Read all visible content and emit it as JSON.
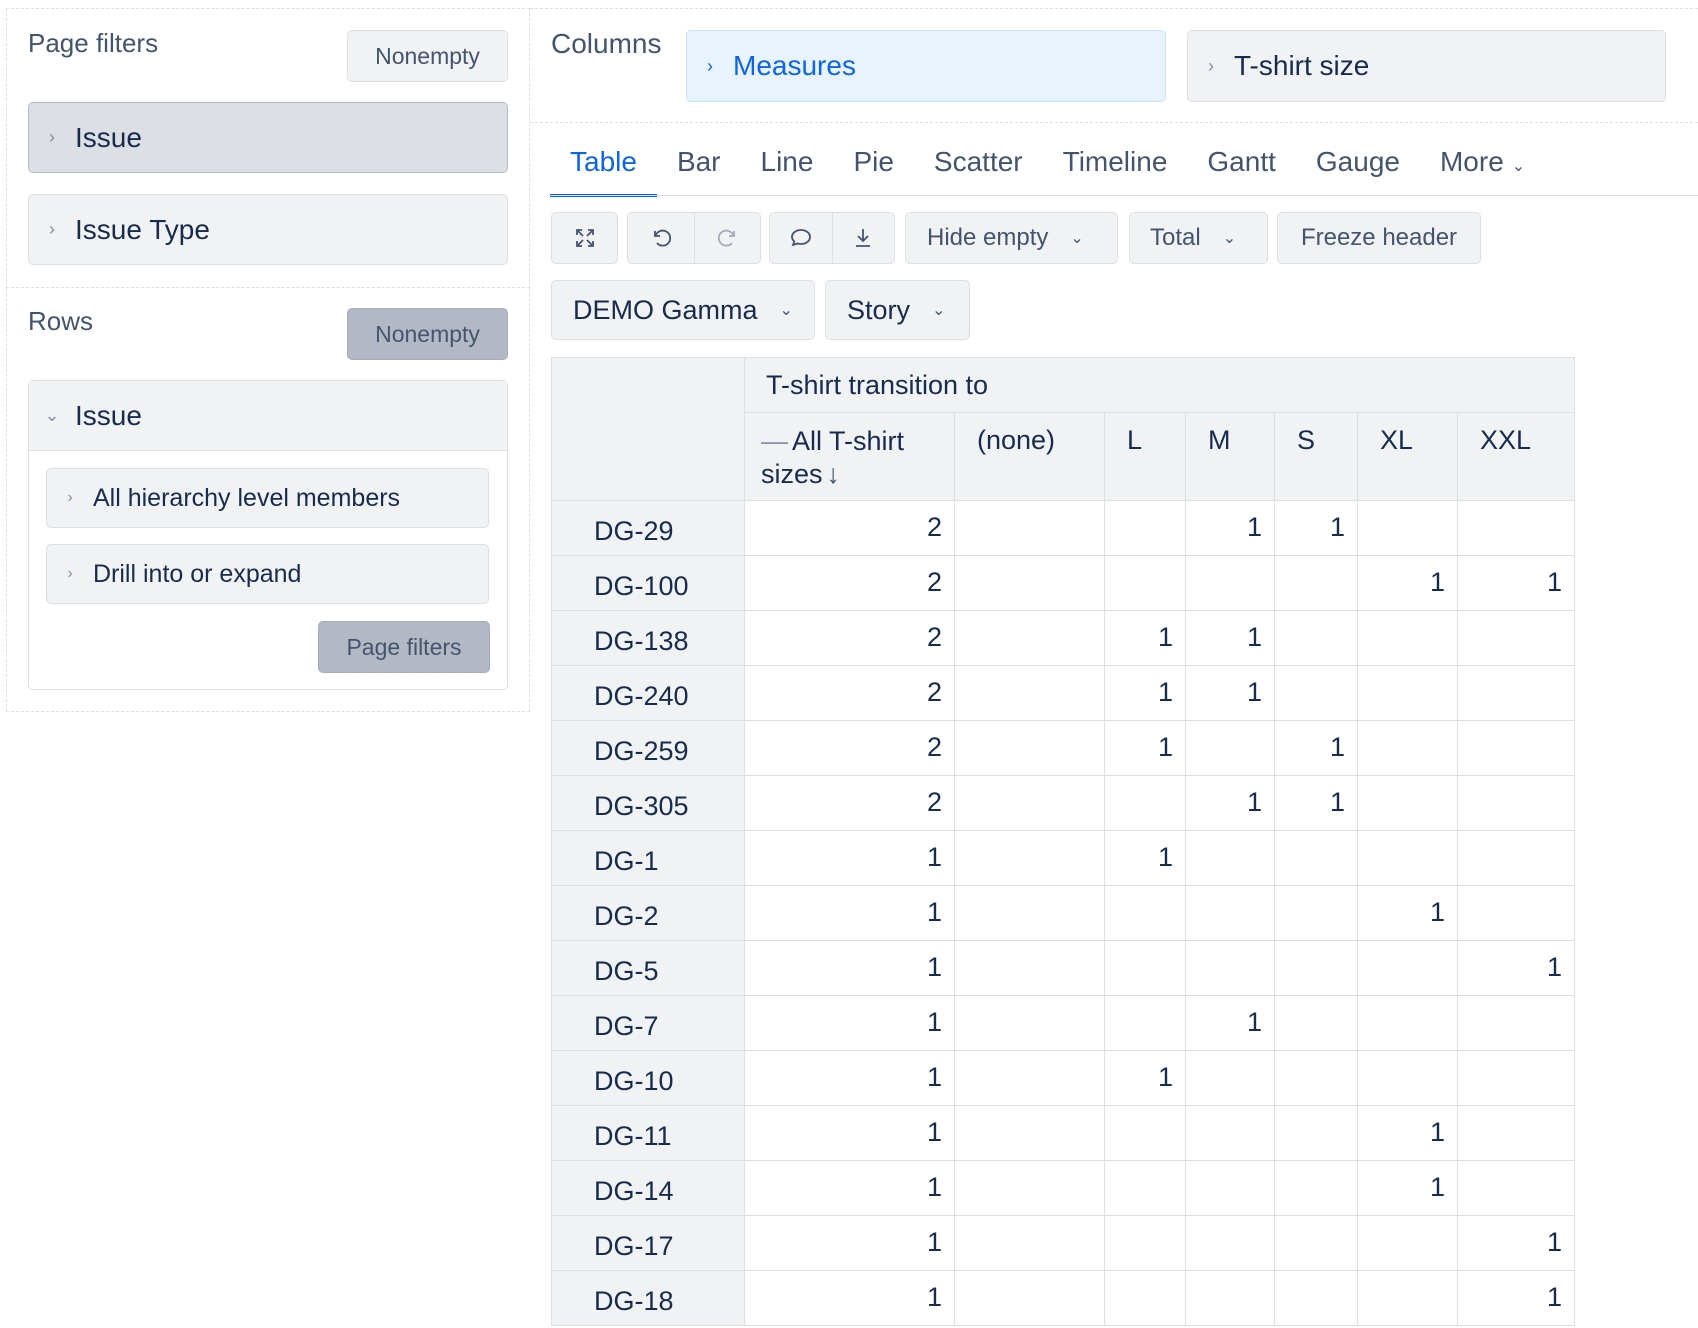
{
  "page_filters": {
    "title": "Page filters",
    "nonempty_label": "Nonempty",
    "items": [
      {
        "label": "Issue",
        "expand_icon": "chevron-right-icon"
      },
      {
        "label": "Issue Type",
        "expand_icon": "chevron-right-icon"
      }
    ]
  },
  "rows": {
    "title": "Rows",
    "nonempty_label": "Nonempty",
    "dimension": {
      "label": "Issue",
      "expand_icon": "chevron-down-icon"
    },
    "options": [
      "All hierarchy level members",
      "Drill into or expand"
    ],
    "page_filters_button": "Page filters"
  },
  "columns": {
    "title": "Columns",
    "items": [
      {
        "label": "Measures"
      },
      {
        "label": "T-shirt size"
      }
    ]
  },
  "tabs": {
    "items": [
      "Table",
      "Bar",
      "Line",
      "Pie",
      "Scatter",
      "Timeline",
      "Gantt",
      "Gauge",
      "More"
    ],
    "active": "Table"
  },
  "toolbar": {
    "icons": [
      "fullscreen-icon",
      "undo-icon",
      "redo-icon",
      "comment-icon",
      "download-icon"
    ],
    "hide_empty": "Hide empty",
    "total": "Total",
    "freeze_header": "Freeze header"
  },
  "filters": {
    "project": "DEMO Gamma",
    "issue_type": "Story"
  },
  "table": {
    "group_header": "T-shirt transition to",
    "columns": [
      "All T-shirt sizes",
      "(none)",
      "L",
      "M",
      "S",
      "XL",
      "XXL"
    ],
    "rows": [
      {
        "label": "DG-29",
        "values": [
          "2",
          "",
          "",
          "1",
          "1",
          "",
          ""
        ]
      },
      {
        "label": "DG-100",
        "values": [
          "2",
          "",
          "",
          "",
          "",
          "1",
          "1"
        ]
      },
      {
        "label": "DG-138",
        "values": [
          "2",
          "",
          "1",
          "1",
          "",
          "",
          ""
        ]
      },
      {
        "label": "DG-240",
        "values": [
          "2",
          "",
          "1",
          "1",
          "",
          "",
          ""
        ]
      },
      {
        "label": "DG-259",
        "values": [
          "2",
          "",
          "1",
          "",
          "1",
          "",
          ""
        ]
      },
      {
        "label": "DG-305",
        "values": [
          "2",
          "",
          "",
          "1",
          "1",
          "",
          ""
        ]
      },
      {
        "label": "DG-1",
        "values": [
          "1",
          "",
          "1",
          "",
          "",
          "",
          ""
        ]
      },
      {
        "label": "DG-2",
        "values": [
          "1",
          "",
          "",
          "",
          "",
          "1",
          ""
        ]
      },
      {
        "label": "DG-5",
        "values": [
          "1",
          "",
          "",
          "",
          "",
          "",
          "1"
        ]
      },
      {
        "label": "DG-7",
        "values": [
          "1",
          "",
          "",
          "1",
          "",
          "",
          ""
        ]
      },
      {
        "label": "DG-10",
        "values": [
          "1",
          "",
          "1",
          "",
          "",
          "",
          ""
        ]
      },
      {
        "label": "DG-11",
        "values": [
          "1",
          "",
          "",
          "",
          "",
          "1",
          ""
        ]
      },
      {
        "label": "DG-14",
        "values": [
          "1",
          "",
          "",
          "",
          "",
          "1",
          ""
        ]
      },
      {
        "label": "DG-17",
        "values": [
          "1",
          "",
          "",
          "",
          "",
          "",
          "1"
        ]
      },
      {
        "label": "DG-18",
        "values": [
          "1",
          "",
          "",
          "",
          "",
          "",
          "1"
        ]
      }
    ]
  },
  "colors": {
    "accent": "#0c66e4",
    "measures_chip_bg": "#e9f2ff",
    "header_bg": "#f1f2f4",
    "border": "#dcdfe4"
  }
}
